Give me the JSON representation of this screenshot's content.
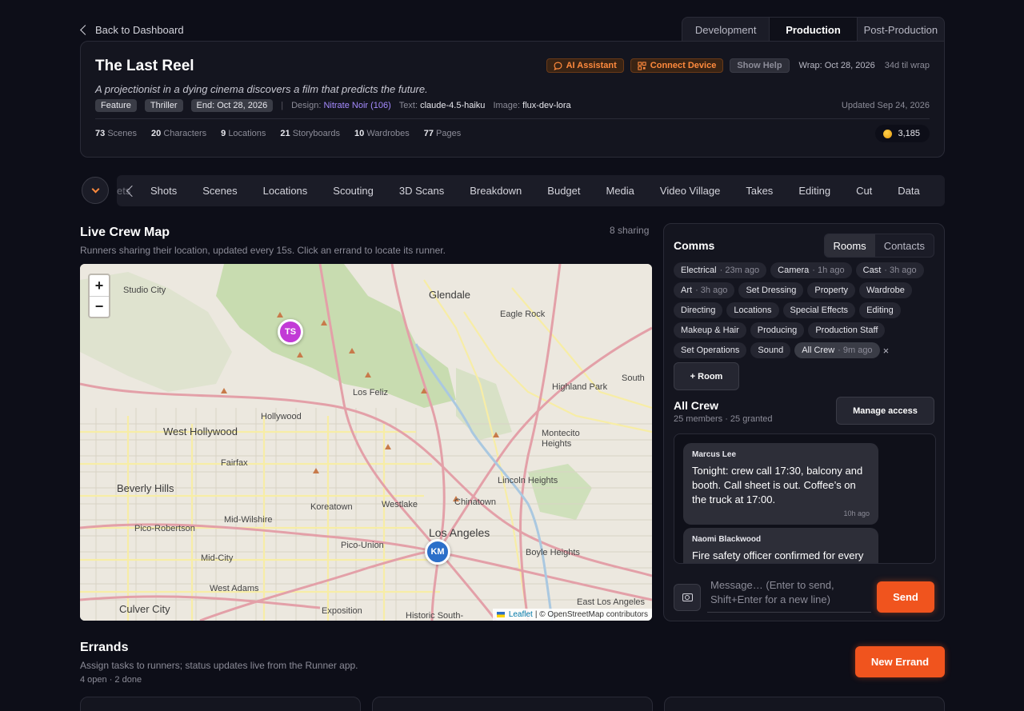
{
  "back_link": "Back to Dashboard",
  "phase_tabs": [
    "Development",
    "Production",
    "Post-Production"
  ],
  "project": {
    "title": "The Last Reel",
    "logline": "A projectionist in a dying cinema discovers a film that predicts the future.",
    "tags": [
      "Feature",
      "Thriller",
      "End: Oct 28, 2026"
    ],
    "design_label": "Design:",
    "design_value": "Nitrate Noir (106)",
    "text_label": "Text:",
    "text_value": "claude-4.5-haiku",
    "image_label": "Image:",
    "image_value": "flux-dev-lora",
    "updated": "Updated Sep 24, 2026",
    "actions": {
      "ai_assistant": "AI Assistant",
      "connect_device": "Connect Device",
      "show_help": "Show Help"
    },
    "wrap": "Wrap: Oct 28, 2026",
    "wrap_remaining": "34d til wrap",
    "stats": [
      {
        "value": "73",
        "label": "Scenes"
      },
      {
        "value": "20",
        "label": "Characters"
      },
      {
        "value": "9",
        "label": "Locations"
      },
      {
        "value": "21",
        "label": "Storyboards"
      },
      {
        "value": "10",
        "label": "Wardrobes"
      },
      {
        "value": "77",
        "label": "Pages"
      }
    ],
    "credits": "3,185"
  },
  "nav": {
    "truncated": "ets",
    "items": [
      "Shots",
      "Scenes",
      "Locations",
      "Scouting",
      "3D Scans",
      "Breakdown",
      "Budget",
      "Media",
      "Video Village",
      "Takes",
      "Editing",
      "Cut",
      "Data"
    ]
  },
  "map_section": {
    "title": "Live Crew Map",
    "subtitle": "Runners sharing their location, updated every 15s. Click an errand to locate its runner.",
    "sharing": "8 sharing",
    "zoom_in": "+",
    "zoom_out": "−",
    "pins": [
      "TS",
      "KM"
    ],
    "labels": {
      "glendale": "Glendale",
      "studio_city": "Studio City",
      "eagle_rock": "Eagle Rock",
      "highland_park": "Highland Park",
      "south": "South",
      "los_feliz": "Los Feliz",
      "hollywood": "Hollywood",
      "west_hollywood": "West Hollywood",
      "montecito_heights": "Montecito\nHeights",
      "fairfax": "Fairfax",
      "beverly_hills": "Beverly Hills",
      "lincoln_heights": "Lincoln Heights",
      "koreatown": "Koreatown",
      "westlake": "Westlake",
      "chinatown": "Chinatown",
      "mid_wilshire": "Mid-Wilshire",
      "pico_robertson": "Pico-Robertson",
      "los_angeles": "Los Angeles",
      "pico_union": "Pico-Union",
      "boyle_heights": "Boyle Heights",
      "mid_city": "Mid-City",
      "west_adams": "West Adams",
      "east_los_angeles": "East Los Angeles",
      "culver_city": "Culver City",
      "exposition": "Exposition",
      "historic_south": "Historic South-"
    },
    "attribution_leaflet": "Leaflet",
    "attribution_rest": "| © OpenStreetMap contributors"
  },
  "comms": {
    "title": "Comms",
    "toggle": [
      "Rooms",
      "Contacts"
    ],
    "rooms": [
      {
        "name": "Electrical",
        "ago": "· 23m ago"
      },
      {
        "name": "Camera",
        "ago": "· 1h ago"
      },
      {
        "name": "Cast",
        "ago": "· 3h ago"
      },
      {
        "name": "Art",
        "ago": "· 3h ago"
      },
      {
        "name": "Set Dressing",
        "ago": ""
      },
      {
        "name": "Property",
        "ago": ""
      },
      {
        "name": "Wardrobe",
        "ago": ""
      },
      {
        "name": "Directing",
        "ago": ""
      },
      {
        "name": "Locations",
        "ago": ""
      },
      {
        "name": "Special Effects",
        "ago": ""
      },
      {
        "name": "Editing",
        "ago": ""
      },
      {
        "name": "Makeup & Hair",
        "ago": ""
      },
      {
        "name": "Producing",
        "ago": ""
      },
      {
        "name": "Production Staff",
        "ago": ""
      },
      {
        "name": "Set Operations",
        "ago": ""
      },
      {
        "name": "Sound",
        "ago": ""
      },
      {
        "name": "All Crew",
        "ago": "· 9m ago"
      }
    ],
    "close_glyph": "×",
    "add_room": "+ Room",
    "room_name": "All Crew",
    "room_members": "25 members · 25 granted",
    "manage_access": "Manage access",
    "messages": [
      {
        "author": "Marcus Lee",
        "text": "Tonight: crew call 17:30, balcony and booth. Call sheet is out. Coffee’s on the truck at 17:00.",
        "time": "10h ago"
      },
      {
        "author": "Naomi Blackwood",
        "text": "Fire safety officer confirmed for every",
        "time": ""
      }
    ],
    "input_placeholder": "Message… (Enter to send, Shift+Enter for a new line)",
    "send": "Send"
  },
  "errands": {
    "title": "Errands",
    "subtitle": "Assign tasks to runners; status updates live from the Runner app.",
    "count": "4 open · 2 done",
    "new_errand": "New Errand"
  }
}
